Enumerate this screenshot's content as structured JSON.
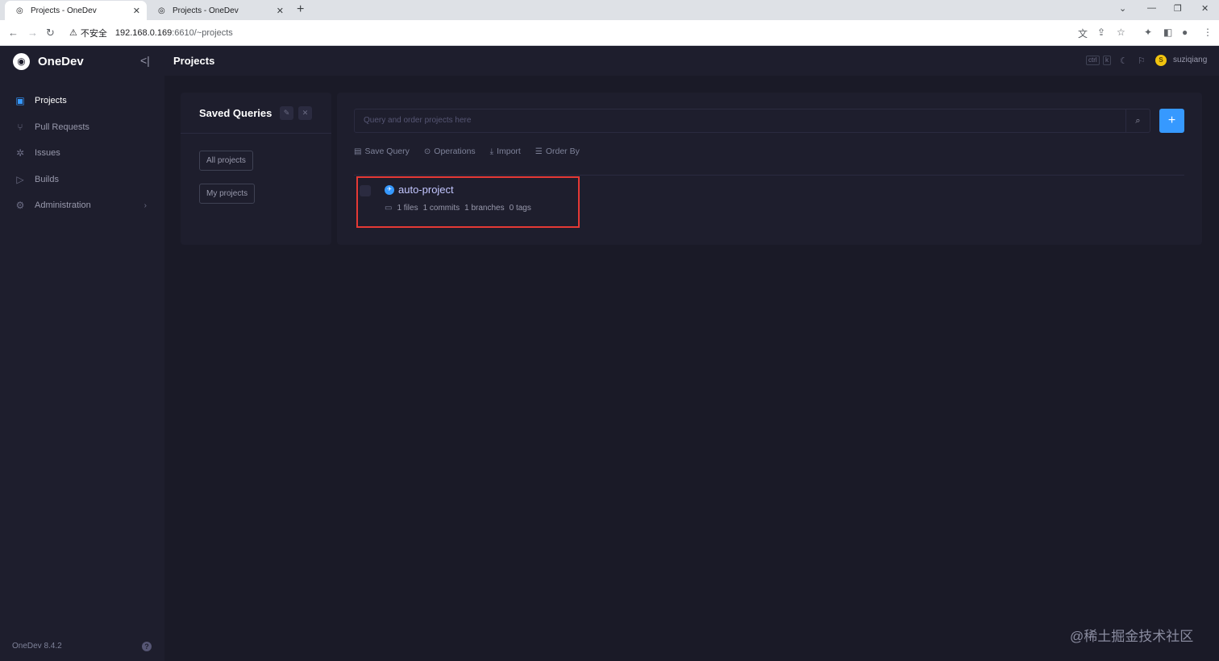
{
  "browser": {
    "tabs": [
      {
        "title": "Projects - OneDev",
        "active": true
      },
      {
        "title": "Projects - OneDev",
        "active": false
      }
    ],
    "security_label": "不安全",
    "url_host": "192.168.0.169",
    "url_path": ":6610/~projects"
  },
  "app": {
    "brand": "OneDev",
    "version": "OneDev 8.4.2",
    "page_title": "Projects",
    "shortcut_keys": [
      "ctrl",
      "k"
    ],
    "username": "suziqiang",
    "avatar_initial": "S",
    "accent_color": "#3699ff"
  },
  "sidebar": {
    "items": [
      {
        "label": "Projects",
        "icon": "projects-icon",
        "active": true
      },
      {
        "label": "Pull Requests",
        "icon": "pull-request-icon",
        "active": false
      },
      {
        "label": "Issues",
        "icon": "bug-icon",
        "active": false
      },
      {
        "label": "Builds",
        "icon": "play-circle-icon",
        "active": false
      },
      {
        "label": "Administration",
        "icon": "gear-icon",
        "active": false
      }
    ]
  },
  "saved_queries": {
    "title": "Saved Queries",
    "items": [
      "All projects",
      "My projects"
    ]
  },
  "main": {
    "search_placeholder": "Query and order projects here",
    "toolbar": {
      "save_query": "Save Query",
      "operations": "Operations",
      "import": "Import",
      "order_by": "Order By"
    },
    "projects": [
      {
        "name": "auto-project",
        "files": "1 files",
        "commits": "1 commits",
        "branches": "1 branches",
        "tags": "0 tags"
      }
    ]
  },
  "watermark": "@稀土掘金技术社区"
}
